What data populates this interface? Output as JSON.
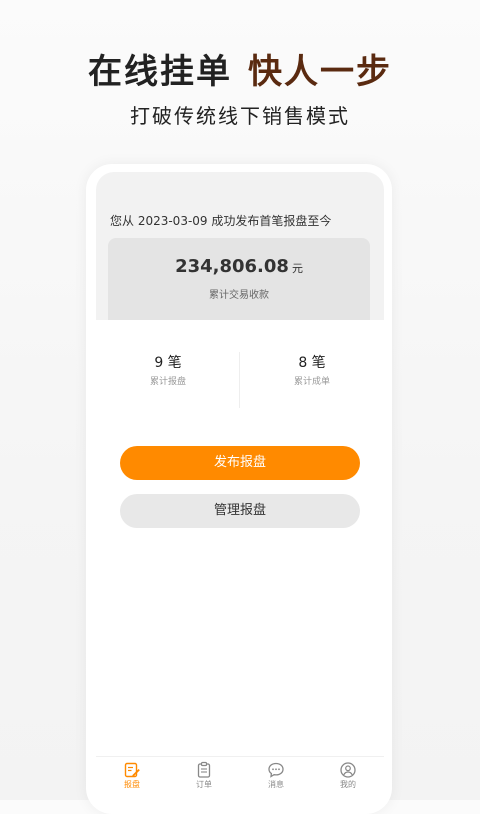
{
  "promo": {
    "headline_part1": "在线挂单",
    "headline_part2": "快人一步",
    "subheadline": "打破传统线下销售模式"
  },
  "summary": {
    "since_text": "您从 2023-03-09 成功发布首笔报盘至今",
    "amount": "234,806.08",
    "amount_unit": "元",
    "amount_label": "累计交易收款"
  },
  "stats": [
    {
      "value": "9 笔",
      "label": "累计报盘"
    },
    {
      "value": "8 笔",
      "label": "累计成单"
    }
  ],
  "actions": {
    "publish_label": "发布报盘",
    "manage_label": "管理报盘"
  },
  "tabbar": {
    "items": [
      {
        "label": "报盘",
        "icon": "edit-document-icon",
        "active": true
      },
      {
        "label": "订单",
        "icon": "clipboard-icon",
        "active": false
      },
      {
        "label": "消息",
        "icon": "chat-bubble-icon",
        "active": false
      },
      {
        "label": "我的",
        "icon": "user-profile-icon",
        "active": false
      }
    ]
  },
  "colors": {
    "accent": "#ff8a00",
    "headline_dark": "#222222",
    "headline_brown": "#5a2a10"
  }
}
